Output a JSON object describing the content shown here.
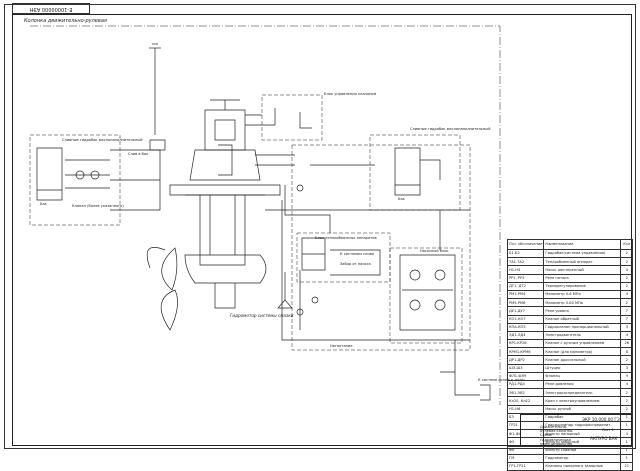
{
  "stamp_top": "Е-10000000 АЭН",
  "scheme_title": "Колонка движительно-рулевая",
  "labels": {
    "block_control_valves": "Блок управления клапаном",
    "block_heat_exchangers": "Блок теплообменных аппаратов",
    "pump_block": "Насосный блок",
    "hydromotor": "Гидромотор системы смазки",
    "tank_left": "Бак",
    "tank_right": "Бак",
    "oil_left": "Сливные гидробак маслонаполнительный",
    "oil_right": "Сливные гидробак маслонаполнительный",
    "to_system": "К системе охлажд. воды",
    "valve_cooling": "Клапан (более указанного)",
    "fill": "Нагнетание",
    "to_drain": "К системам слива",
    "from_pump": "Забор от насоса",
    "to_tank": "Слив в бак"
  },
  "spec": {
    "headers": [
      "Поз. обозначение",
      "Наименование",
      "Кол"
    ],
    "rows": [
      [
        "Б1-Б2",
        "Гидробак(система управления)",
        "2"
      ],
      [
        "ТА1-ТА2",
        "Теплообменный аппарат",
        "2"
      ],
      [
        "Н1-Н4",
        "Насос шестеренный",
        "4"
      ],
      [
        "РР1, РР2",
        "Реле потока",
        "2"
      ],
      [
        "ДТ1, ДТ2",
        "Терморегулирование",
        "2"
      ],
      [
        "РМ1-РМ4",
        "Манометр 0-6 МПа",
        "4"
      ],
      [
        "РМ5-РМ6",
        "Манометр 0-60 МПа",
        "2"
      ],
      [
        "ДУ1-ДУ7",
        "Реле уровня",
        "7"
      ],
      [
        "КО1-КО7",
        "Клапан обратный",
        "7"
      ],
      [
        "КПА-КП3",
        "Гидроклапан пропорциональный",
        "3"
      ],
      [
        "ЭД1-ЭД4",
        "Электродвигатель",
        "4"
      ],
      [
        "КР1-КР26",
        "Клапан с ручным управлением",
        "26"
      ],
      [
        "КРМ1-КРМ6",
        "Клапан (для манометра)",
        "6"
      ],
      [
        "ДР1-ДР2",
        "Клапан дроссельный",
        "2"
      ],
      [
        "ШЗ-Ш3",
        "Штуцер",
        "3"
      ],
      [
        "ФЛ1-ФЛ9",
        "Фланец",
        "9"
      ],
      [
        "РД1-РД4",
        "Реле давления",
        "4"
      ],
      [
        "ЭВ1-ЭВ2",
        "Электрораспределитель",
        "2"
      ],
      [
        "Кл20, Кл22",
        "Кран с электроуправлением",
        "2"
      ],
      [
        "Н1-Н6",
        "Насос ручной",
        "2"
      ],
      [
        "БЗ",
        "Гидробак",
        "1"
      ],
      [
        "ГР21",
        "Гидроцилиндр гидрораспределит.",
        "1"
      ],
      [
        "Ф1-Ф4",
        "Фильтр напорный",
        "4"
      ],
      [
        "Ф5",
        "Фильтр заборный",
        "1"
      ],
      [
        "Ф6",
        "Фильтр сливной",
        "1"
      ],
      [
        "ГМ",
        "Гидромотор",
        "1"
      ],
      [
        "ГР1-ГР21",
        "Клапаны напорного запорные",
        "21"
      ]
    ]
  },
  "title_block": {
    "code": "ЭКР 10.000.00 ГЗ",
    "name": "Движительно-рулевая колонка. Схема гидравлическая принципиальная",
    "org": "АКПУРО ВАК",
    "sheet": "Лист 1"
  }
}
